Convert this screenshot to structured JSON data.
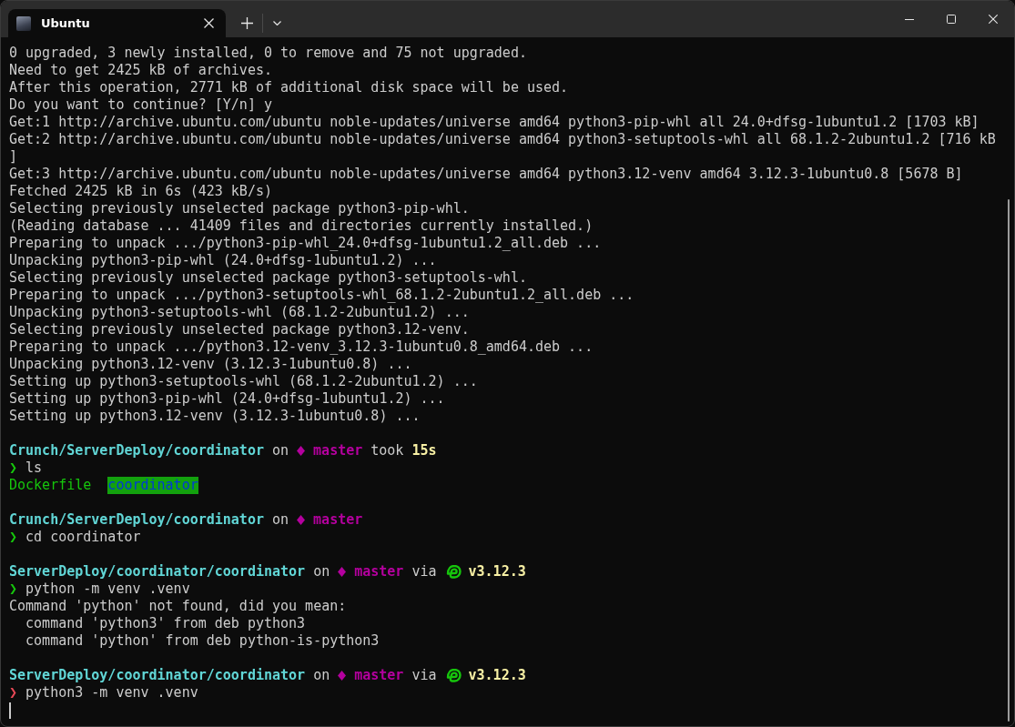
{
  "tab_bar": {
    "tabs": [
      {
        "title": "Ubuntu",
        "selected": true
      }
    ]
  },
  "terminal": {
    "lines": [
      {
        "kind": "output",
        "text": "0 upgraded, 3 newly installed, 0 to remove and 75 not upgraded."
      },
      {
        "kind": "output",
        "text": "Need to get 2425 kB of archives."
      },
      {
        "kind": "output",
        "text": "After this operation, 2771 kB of additional disk space will be used."
      },
      {
        "kind": "output",
        "text": "Do you want to continue? [Y/n] y"
      },
      {
        "kind": "output",
        "text": "Get:1 http://archive.ubuntu.com/ubuntu noble-updates/universe amd64 python3-pip-whl all 24.0+dfsg-1ubuntu1.2 [1703 kB]"
      },
      {
        "kind": "output",
        "text": "Get:2 http://archive.ubuntu.com/ubuntu noble-updates/universe amd64 python3-setuptools-whl all 68.1.2-2ubuntu1.2 [716 kB"
      },
      {
        "kind": "output",
        "text": "]"
      },
      {
        "kind": "output",
        "text": "Get:3 http://archive.ubuntu.com/ubuntu noble-updates/universe amd64 python3.12-venv amd64 3.12.3-1ubuntu0.8 [5678 B]"
      },
      {
        "kind": "output",
        "text": "Fetched 2425 kB in 6s (423 kB/s)"
      },
      {
        "kind": "output",
        "text": "Selecting previously unselected package python3-pip-whl."
      },
      {
        "kind": "output",
        "text": "(Reading database ... 41409 files and directories currently installed.)"
      },
      {
        "kind": "output",
        "text": "Preparing to unpack .../python3-pip-whl_24.0+dfsg-1ubuntu1.2_all.deb ..."
      },
      {
        "kind": "output",
        "text": "Unpacking python3-pip-whl (24.0+dfsg-1ubuntu1.2) ..."
      },
      {
        "kind": "output",
        "text": "Selecting previously unselected package python3-setuptools-whl."
      },
      {
        "kind": "output",
        "text": "Preparing to unpack .../python3-setuptools-whl_68.1.2-2ubuntu1.2_all.deb ..."
      },
      {
        "kind": "output",
        "text": "Unpacking python3-setuptools-whl (68.1.2-2ubuntu1.2) ..."
      },
      {
        "kind": "output",
        "text": "Selecting previously unselected package python3.12-venv."
      },
      {
        "kind": "output",
        "text": "Preparing to unpack .../python3.12-venv_3.12.3-1ubuntu0.8_amd64.deb ..."
      },
      {
        "kind": "output",
        "text": "Unpacking python3.12-venv (3.12.3-1ubuntu0.8) ..."
      },
      {
        "kind": "output",
        "text": "Setting up python3-setuptools-whl (68.1.2-2ubuntu1.2) ..."
      },
      {
        "kind": "output",
        "text": "Setting up python3-pip-whl (24.0+dfsg-1ubuntu1.2) ..."
      },
      {
        "kind": "output",
        "text": "Setting up python3.12-venv (3.12.3-1ubuntu0.8) ..."
      },
      {
        "kind": "blank"
      },
      {
        "kind": "prompt",
        "segments": [
          {
            "kind": "path",
            "text": "Crunch/ServerDeploy/coordinator"
          },
          {
            "kind": "plain",
            "text": "on"
          },
          {
            "kind": "branch",
            "text": "master"
          },
          {
            "kind": "plain",
            "text": "took"
          },
          {
            "kind": "duration",
            "text": "15s"
          }
        ]
      },
      {
        "kind": "command",
        "success": true,
        "symbol": "❯",
        "text": "ls"
      },
      {
        "kind": "listing",
        "entries": [
          {
            "kind": "file",
            "text": "Dockerfile"
          },
          {
            "kind": "directory",
            "text": "coordinator"
          }
        ]
      },
      {
        "kind": "blank"
      },
      {
        "kind": "prompt",
        "segments": [
          {
            "kind": "path",
            "text": "Crunch/ServerDeploy/coordinator"
          },
          {
            "kind": "plain",
            "text": "on"
          },
          {
            "kind": "branch",
            "text": "master"
          }
        ]
      },
      {
        "kind": "command",
        "success": true,
        "symbol": "❯",
        "text": "cd coordinator"
      },
      {
        "kind": "blank"
      },
      {
        "kind": "prompt",
        "segments": [
          {
            "kind": "path",
            "text": "ServerDeploy/coordinator/coordinator"
          },
          {
            "kind": "plain",
            "text": "on"
          },
          {
            "kind": "branch",
            "text": "master"
          },
          {
            "kind": "plain",
            "text": "via"
          },
          {
            "kind": "version",
            "text": "v3.12.3"
          }
        ]
      },
      {
        "kind": "command",
        "success": true,
        "symbol": "❯",
        "text": "python -m venv .venv"
      },
      {
        "kind": "output",
        "text": "Command 'python' not found, did you mean:"
      },
      {
        "kind": "hint",
        "text": "command 'python3' from deb python3"
      },
      {
        "kind": "hint",
        "text": "command 'python' from deb python-is-python3"
      },
      {
        "kind": "blank"
      },
      {
        "kind": "prompt",
        "segments": [
          {
            "kind": "path",
            "text": "ServerDeploy/coordinator/coordinator"
          },
          {
            "kind": "plain",
            "text": "on"
          },
          {
            "kind": "branch",
            "text": "master"
          },
          {
            "kind": "plain",
            "text": "via"
          },
          {
            "kind": "version",
            "text": "v3.12.3"
          }
        ]
      },
      {
        "kind": "command",
        "success": false,
        "symbol": "❯",
        "text": "python3 -m venv .venv"
      },
      {
        "kind": "cursor"
      }
    ]
  }
}
